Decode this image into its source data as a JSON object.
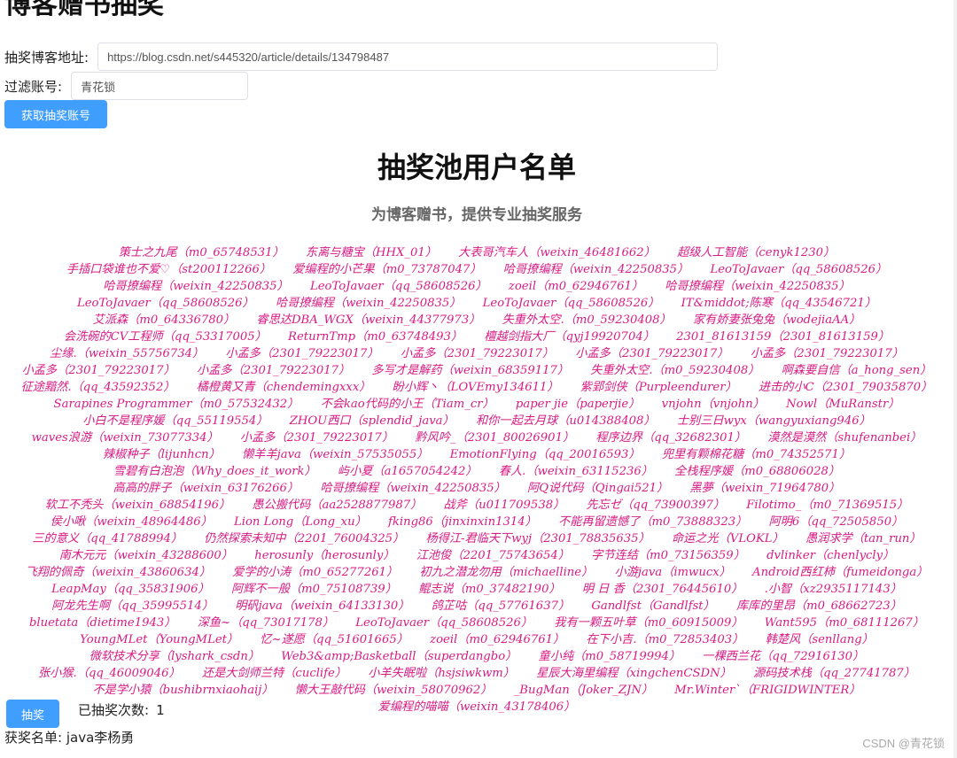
{
  "page": {
    "title": "博客赠书抽奖"
  },
  "form": {
    "blog_url_label": "抽奖博客地址:",
    "blog_url_value": "https://blog.csdn.net/s445320/article/details/134798487",
    "filter_label": "过滤账号:",
    "filter_value": "青花锁",
    "fetch_button": "获取抽奖账号"
  },
  "pool": {
    "title": "抽奖池用户名单",
    "subtitle": "为博客赠书，提供专业抽奖服务",
    "users": [
      "策士之九尾（m0_65748531）",
      "东离与糖宝（HHX_01）",
      "大表哥汽车人（weixin_46481662）",
      "超级人工智能（cenyk1230）",
      "手插口袋谁也不爱♡（st200112266）",
      "爱编程的小芒果（m0_73787047）",
      "哈哥撩编程（weixin_42250835）",
      "LeoToJavaer（qq_58608526）",
      "哈哥撩编程（weixin_42250835）",
      "LeoToJavaer（qq_58608526）",
      "zoeil（m0_62946761）",
      "哈哥撩编程（weixin_42250835）",
      "LeoToJavaer（qq_58608526）",
      "哈哥撩编程（weixin_42250835）",
      "LeoToJavaer（qq_58608526）",
      "IT&middot;陈寒（qq_43546721）",
      "艾派森（m0_64336780）",
      "睿思达DBA_WGX（weixin_44377973）",
      "失重外太空.（m0_59230408）",
      "家有娇妻张兔兔（wodejiaAA）",
      "会洗碗的CV工程师（qq_53317005）",
      "ReturnTmp（m0_63748493）",
      "檀越剑指大厂（qyj19920704）",
      "2301_81613159（2301_81613159）",
      "尘缘.（weixin_55756734）",
      "小孟多（2301_79223017）",
      "小孟多（2301_79223017）",
      "小孟多（2301_79223017）",
      "小孟多（2301_79223017）",
      "小孟多（2301_79223017）",
      "小孟多（2301_79223017）",
      "多写才是解药（weixin_68359117）",
      "失重外太空.（m0_59230408）",
      "啊森要自信（a_hong_sen）",
      "征途黯然.（qq_43592352）",
      "橘橙黄又青（chendemingxxx）",
      "盼小辉丶（LOVEmy134611）",
      "紫郢剑侠（Purpleendurer）",
      "进击的小C（2301_79035870）",
      "Sarapines Programmer（m0_57532432）",
      "不会kao代码的小王（Tiam_cr）",
      "paper jie（paperjie）",
      "vnjohn（vnjohn）",
      "Nowl（MuRanstr）",
      "小白不是程序媛（qq_55119554）",
      "ZHOU西口（splendid_java）",
      "和你一起去月球（u014388408）",
      "士别三日wyx（wangyuxiang946）",
      "waves浪游（weixin_73077334）",
      "小孟多（2301_79223017）",
      "黔风吟_（2301_80026901）",
      "程序边界（qq_32682301）",
      "漠然是漠然（shufenanbei）",
      "辣椒种子（lijunhcn）",
      "懒羊羊java（weixin_57535055）",
      "EmotionFlying（qq_20016593）",
      "兜里有颗棉花糖（m0_74352571）",
      "雪碧有白泡泡（Why_does_it_work）",
      "屿小夏（a1657054242）",
      "春人.（weixin_63115236）",
      "全栈程序媛（m0_68806028）",
      "高高的胖子（weixin_63176266）",
      "哈哥撩编程（weixin_42250835）",
      "阿Q说代码（Qingai521）",
      "黑夢（weixin_71964780）",
      "软工不秃头（weixin_68854196）",
      "愚公搬代码（aa2528877987）",
      "战斧（u011709538）",
      "先忘ゼ（qq_73900397）",
      "Filotimo_（m0_71369515）",
      "侯小啾（weixin_48964486）",
      "Lion Long（Long_xu）",
      "fking86（jinxinxin1314）",
      "不能再留遗憾了（m0_73888323）",
      "阿明6（qq_72505850）",
      "三的意义（qq_41788994）",
      "仍然探索未知中（2201_76004325）",
      "杨得江-君临天下wyj（2301_78835635）",
      "命运之光（VLOKL）",
      "愚润求学（tan_run）",
      "南木元元（weixin_43288600）",
      "herosunly（herosunly）",
      "江池俊（2201_75743654）",
      "字节连结（m0_73156359）",
      "dvlinker（chenlycly）",
      "飞翔的佩奇（weixin_43860634）",
      "爱学的小涛（m0_65277261）",
      "初九之潜龙勿用（michaelline）",
      "小游java（imwucx）",
      "Android西红柿（fumeidonga）",
      "LeapMay（qq_35831906）",
      "阿辉不一般（m0_75108739）",
      "鲲志说（m0_37482190）",
      "明 日 香（2301_76445610）",
      ".小智（xz2935117143）",
      "阿龙先生啊（qq_35995514）",
      "明矾java（weixin_64133130）",
      "鸽芷咕（qq_57761637）",
      "Gandlfst（Gandlfst）",
      "库库的里昂（m0_68662723）",
      "bluetata（dietime1943）",
      "深鱼~（qq_73017178）",
      "LeoToJavaer（qq_58608526）",
      "我有一颗五叶草（m0_60915009）",
      "Want595（m0_68111267）",
      "YoungMLet（YoungMLet）",
      "忆~遂愿（qq_51601665）",
      "zoeil（m0_62946761）",
      "在下小吉.（m0_72853403）",
      "韩楚风（senllang）",
      "微软技术分享（lyshark_csdn）",
      "Web3&amp;Basketball（superdangbo）",
      "童小纯（m0_58719994）",
      "一棵西兰花（qq_72916130）",
      "张小猴.（qq_46009046）",
      "还是大剑师兰特（cuclife）",
      "小羊失眠啦（hsjsiwkwm）",
      "星辰大海里编程（xingchenCSDN）",
      "源码技术栈（qq_27741787）",
      "不是学小猿（bushibrnxiaohaij）",
      "懒大王敲代码（weixin_58070962）",
      "_BugMan（Joker_ZJN）",
      "Mr.Winter`（FRIGIDWINTER）",
      "爱编程的喵喵（weixin_43178406）"
    ]
  },
  "draw": {
    "button": "抽奖",
    "count_label": "已抽奖次数:",
    "count_value": "1",
    "winner_label": "获奖名单:",
    "winner_value": "java李杨勇"
  },
  "watermark": "CSDN @青花锁",
  "colors": {
    "accent": "#409eff",
    "pool_text": "#d81b84"
  }
}
